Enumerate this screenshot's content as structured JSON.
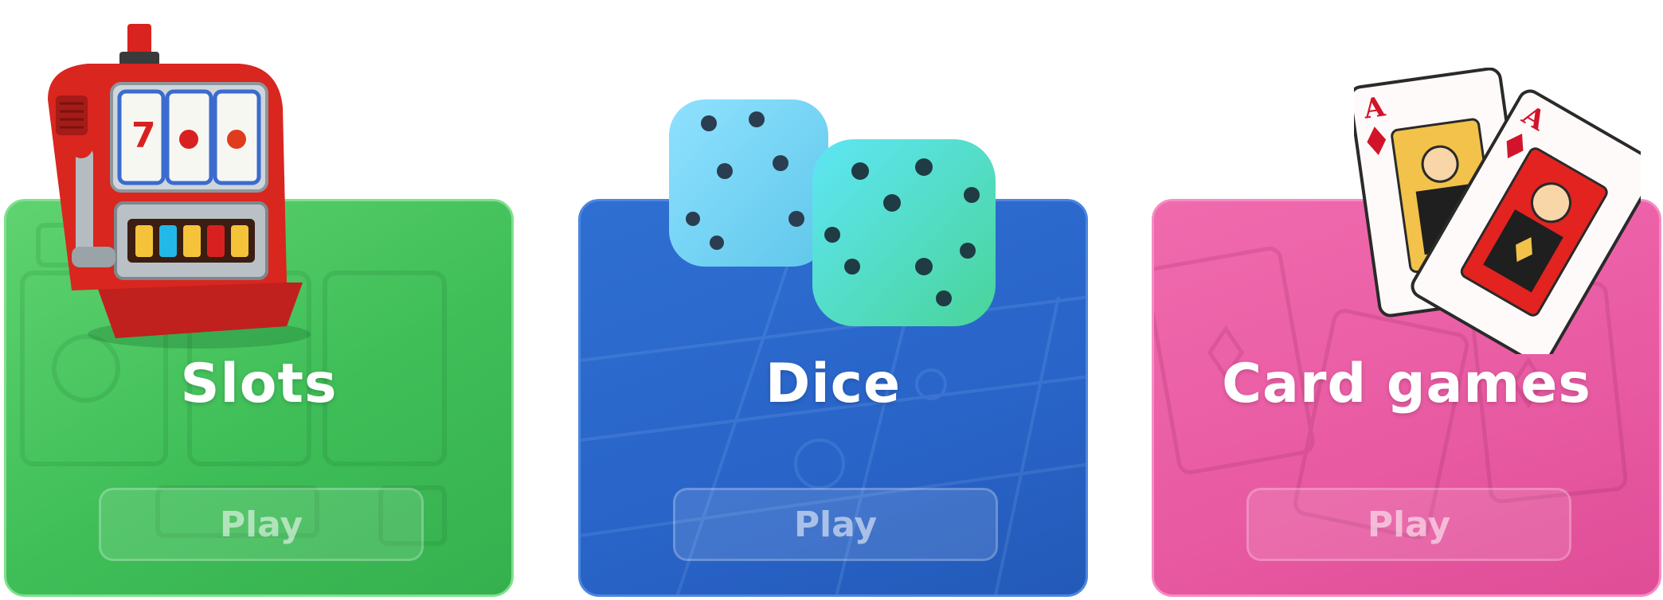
{
  "cards": [
    {
      "title": "Slots",
      "button_label": "Play"
    },
    {
      "title": "Dice",
      "button_label": "Play"
    },
    {
      "title": "Card games",
      "button_label": "Play"
    }
  ],
  "icons": {
    "slots": "slot-machine-icon",
    "dice": "dice-icon",
    "cards": "playing-cards-icon"
  },
  "colors": {
    "slots_card": "#3fbe58",
    "dice_card": "#2964c8",
    "cards_card": "#e85aa2",
    "title_text": "#ffffff"
  }
}
